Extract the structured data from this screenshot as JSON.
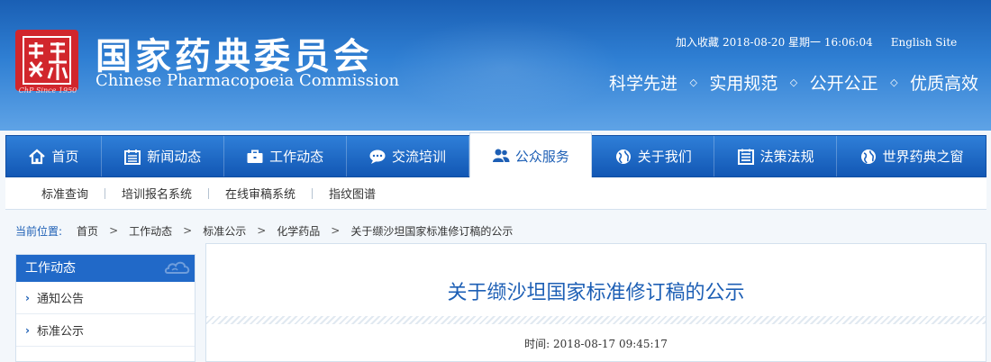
{
  "header": {
    "logo_text": "藥典",
    "logo_caption": "ChP Since 1950",
    "title_cn": "国家药典委员会",
    "title_en": "Chinese Pharmacopoeia Commission",
    "bookmark": "加入收藏",
    "datetime": "2018-08-20 星期一 16:06:04",
    "english_site": "English Site",
    "slogans": [
      "科学先进",
      "实用规范",
      "公开公正",
      "优质高效"
    ],
    "slogan_separator": "◇"
  },
  "nav": {
    "items": [
      {
        "label": "首页",
        "icon": "home-icon"
      },
      {
        "label": "新闻动态",
        "icon": "calendar-icon"
      },
      {
        "label": "工作动态",
        "icon": "briefcase-icon"
      },
      {
        "label": "交流培训",
        "icon": "chat-icon"
      },
      {
        "label": "公众服务",
        "icon": "users-icon",
        "active": true
      },
      {
        "label": "关于我们",
        "icon": "globe-icon"
      },
      {
        "label": "法策法规",
        "icon": "list-icon"
      },
      {
        "label": "世界药典之窗",
        "icon": "globe-icon"
      }
    ]
  },
  "subnav": {
    "items": [
      "标准查询",
      "培训报名系统",
      "在线审稿系统",
      "指纹图谱"
    ]
  },
  "breadcrumb": {
    "lead": "当前位置:",
    "items": [
      "首页",
      "工作动态",
      "标准公示",
      "化学药品",
      "关于缬沙坦国家标准修订稿的公示"
    ],
    "separator": ">"
  },
  "sidebar": {
    "title": "工作动态",
    "items": [
      "通知公告",
      "标准公示"
    ],
    "chevron": "›"
  },
  "article": {
    "title": "关于缬沙坦国家标准修订稿的公示",
    "time": "时间: 2018-08-17 09:45:17"
  },
  "colors": {
    "brand_blue": "#1d5fb5",
    "seal_red": "#d1262c",
    "nav_blue": "#1257b4"
  }
}
